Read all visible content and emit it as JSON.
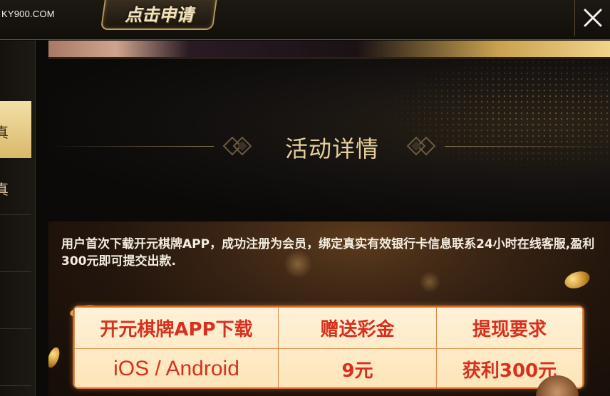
{
  "header": {
    "site_url": "KY900.COM",
    "apply_button_label": "点击申请",
    "close_icon": "close-icon"
  },
  "sidebar": {
    "tabs": [
      {
        "char": "真",
        "active": true
      },
      {
        "char": "真",
        "active": false
      },
      {
        "char": "",
        "active": false
      },
      {
        "char": "",
        "active": false
      },
      {
        "char": "",
        "active": false
      }
    ]
  },
  "details": {
    "title": "活动详情",
    "description": "用户首次下载开元棋牌APP，成功注册为会员，绑定真实有效银行卡信息联系24小时在线客服,盈利300元即可提交出款.",
    "table": {
      "headers": [
        "开元棋牌APP下载",
        "赠送彩金",
        "提现要求"
      ],
      "row": [
        "iOS / Android",
        "9元",
        "获利300元"
      ]
    }
  },
  "colors": {
    "accent_gold": "#e6cf9b",
    "table_text": "#d8301e",
    "table_border": "#d76a28"
  }
}
